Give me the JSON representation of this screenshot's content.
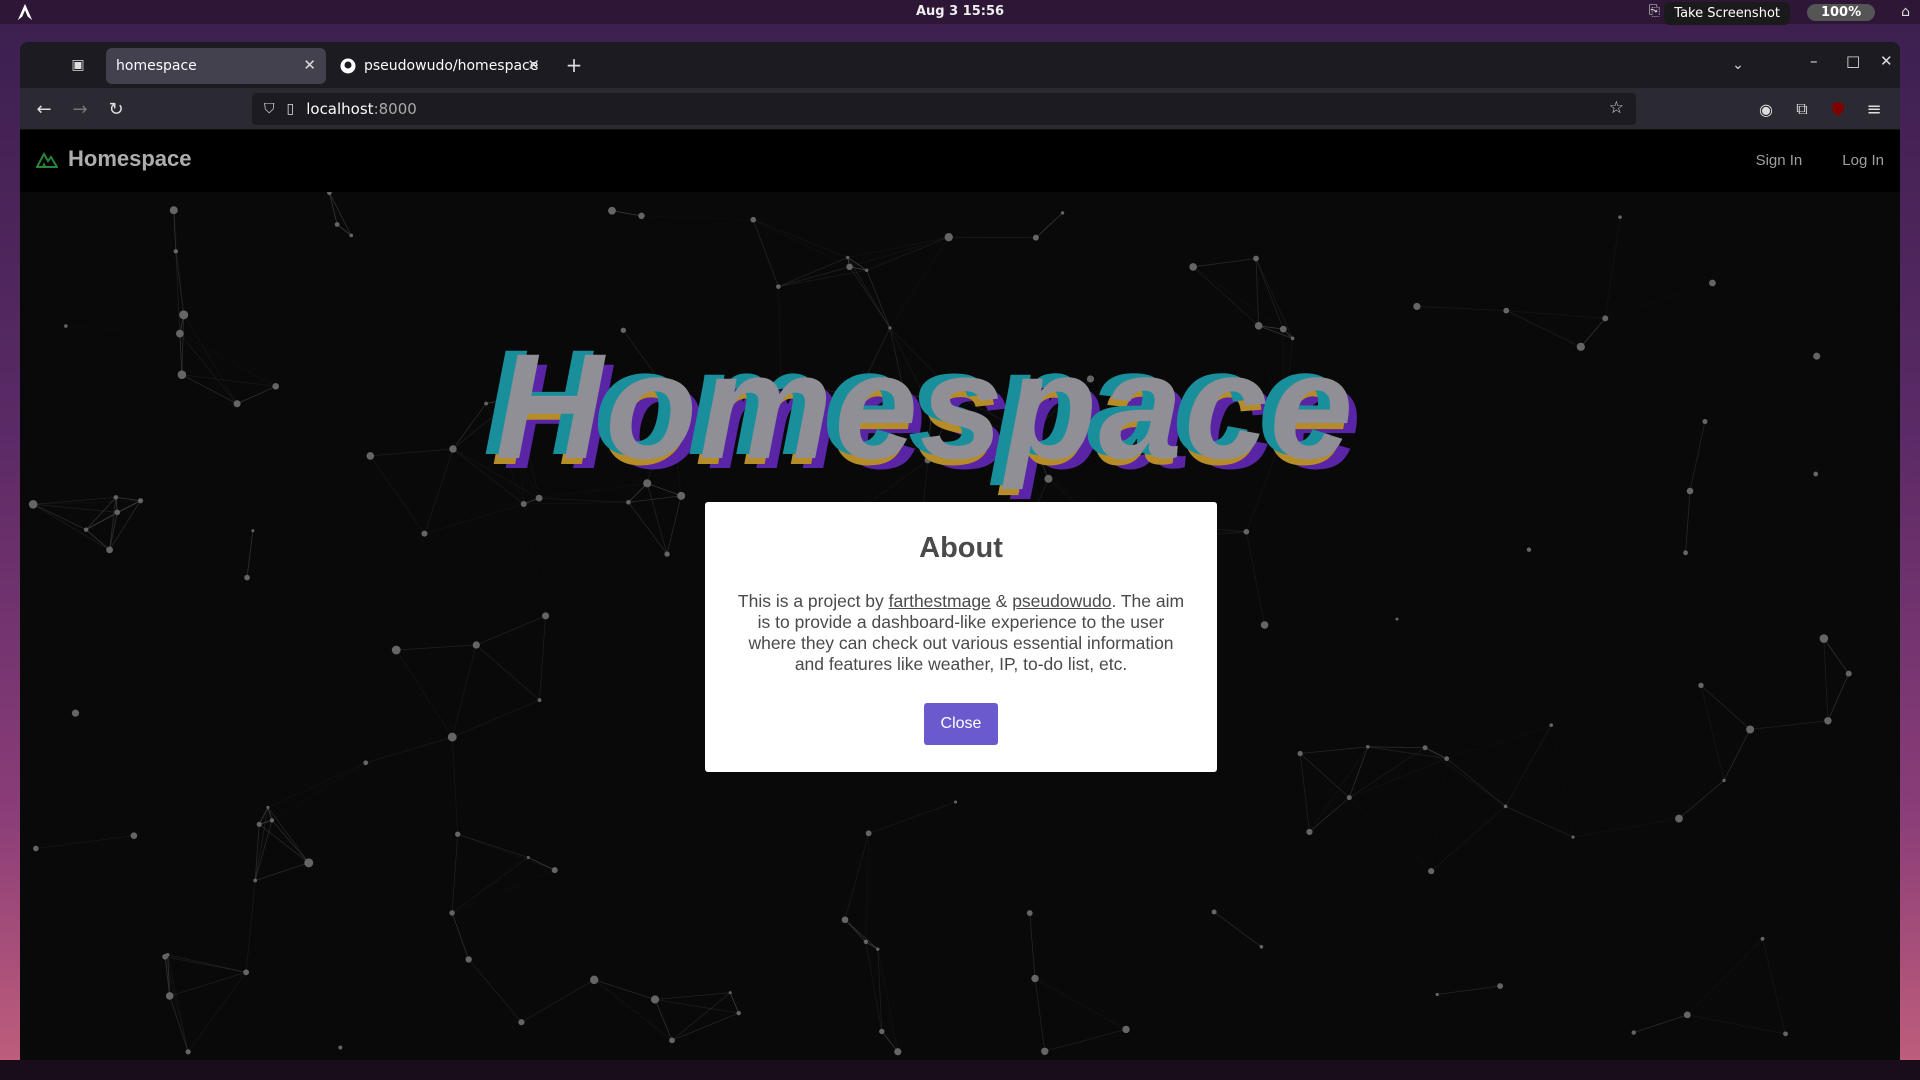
{
  "system": {
    "clock": "Aug 3  15:56",
    "tooltip": "Take Screenshot",
    "battery": "100%"
  },
  "browser": {
    "tabs": [
      {
        "label": "homespace",
        "active": true
      },
      {
        "label": "pseudowudo/homespace",
        "active": false
      }
    ],
    "url_host": "localhost",
    "url_port": ":8000"
  },
  "app": {
    "brand": "Homespace",
    "nav": {
      "sign_in": "Sign In",
      "log_in": "Log In"
    },
    "hero_text": "Homespace"
  },
  "modal": {
    "title": "About",
    "text_1": "This is a project by ",
    "link_1": "farthestmage",
    "text_2": " & ",
    "link_2": "pseudowudo",
    "text_3": ". The aim is to provide a dashboard-like experience to the user where they can check out various essential information and features like weather, IP, to-do list, etc.",
    "close_label": "Close"
  },
  "colors": {
    "accent": "#6a5acd",
    "hero_cyan": "#1fa8b8",
    "hero_gold": "#d6a531",
    "hero_purple": "#6a2bc4"
  }
}
